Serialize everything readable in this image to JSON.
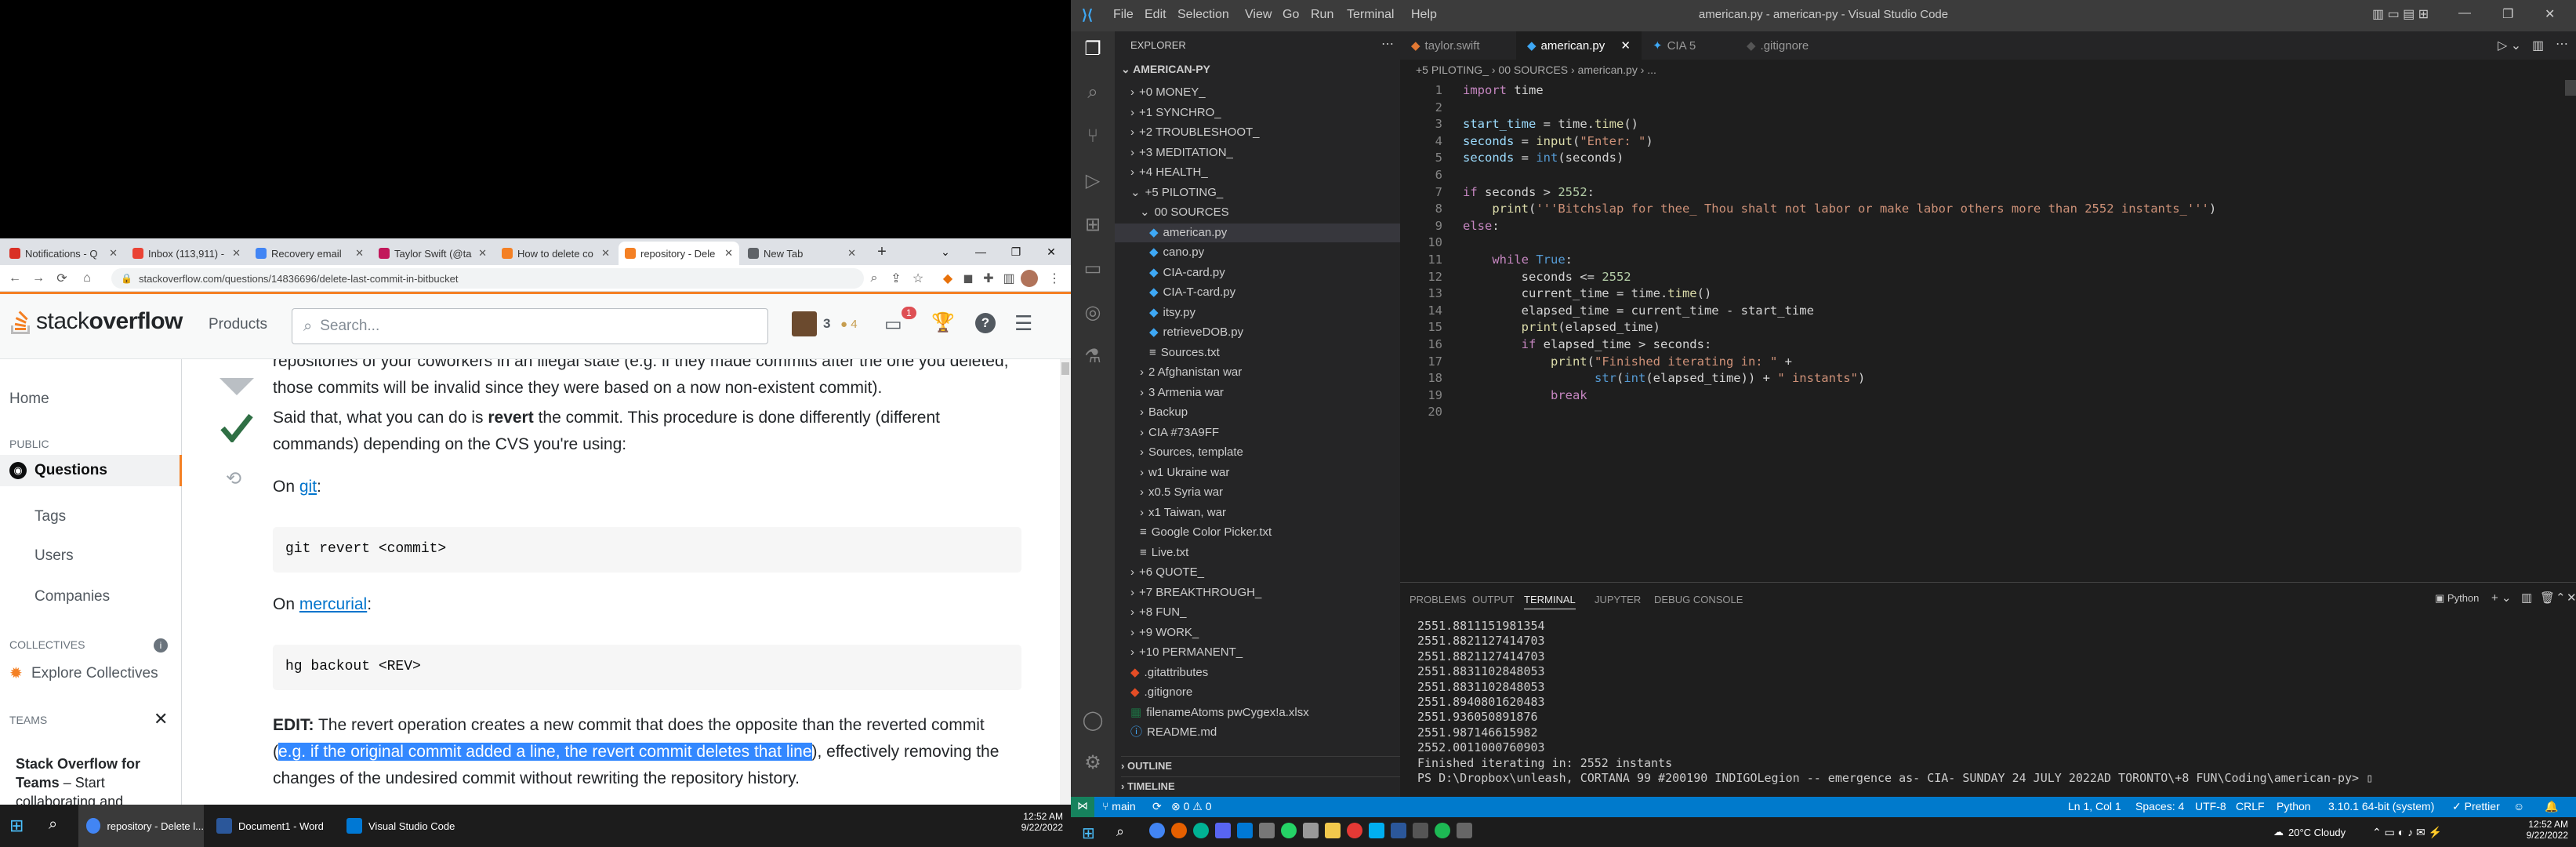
{
  "browser": {
    "tabs": [
      {
        "label": "Notifications - Q",
        "icon_color": "#d93025"
      },
      {
        "label": "Inbox (113,911) -",
        "icon_color": "#ea4335"
      },
      {
        "label": "Recovery email",
        "icon_color": "#4285f4"
      },
      {
        "label": "Taylor Swift (@ta",
        "icon_color": "#c2185b"
      },
      {
        "label": "How to delete co",
        "icon_color": "#f48024"
      },
      {
        "label": "repository - Dele",
        "icon_color": "#f48024"
      },
      {
        "label": "New Tab",
        "icon_color": "#5f6368"
      }
    ],
    "url": "stackoverflow.com/questions/14836696/delete-last-commit-in-bitbucket",
    "window_buttons": [
      "⌄",
      "—",
      "❐",
      "✕"
    ]
  },
  "so": {
    "logo_text_light": "stack",
    "logo_text_bold": "overflow",
    "products": "Products",
    "search_placeholder": "Search...",
    "rep": "3",
    "badges": "● 4",
    "inbox_count": "1",
    "nav": {
      "home": "Home",
      "public": "PUBLIC",
      "questions": "Questions",
      "tags": "Tags",
      "users": "Users",
      "companies": "Companies",
      "collectives": "COLLECTIVES",
      "explore_collectives": "Explore Collectives",
      "teams": "TEAMS",
      "teams_promo_title": "Stack Overflow for Teams",
      "teams_promo_text": "– Start collaborating and"
    },
    "answer": {
      "para0": "repositories of your coworkers in an illegal state (e.g. if they made commits after the one you deleted, those commits will be invalid since they were based on a now non-existent commit).",
      "para1_a": "Said that, what you can do is ",
      "para1_bold": "revert",
      "para1_b": " the commit. This procedure is done differently (different commands) depending on the CVS you're using:",
      "on_git_a": "On ",
      "on_git_link": "git",
      "on_git_b": ":",
      "code_git": "git revert <commit>",
      "on_hg_a": "On ",
      "on_hg_link": "mercurial",
      "on_hg_b": ":",
      "code_hg": "hg backout <REV>",
      "edit_bold": "EDIT:",
      "edit_a": " The revert operation creates a new commit that does the opposite than the reverted commit (",
      "edit_sel": "e.g. if the original commit added a line, the revert commit deletes that line",
      "edit_b": "), effectively removing the changes of the undesired commit without rewriting the repository history."
    }
  },
  "vscode": {
    "title": "american.py - american-py - Visual Studio Code",
    "menu": [
      "File",
      "Edit",
      "Selection",
      "View",
      "Go",
      "Run",
      "Terminal",
      "Help"
    ],
    "explorer_title": "EXPLORER",
    "root": "AMERICAN-PY",
    "tree": [
      {
        "label": "+0 MONEY_",
        "indent": 1,
        "kind": "folder-closed"
      },
      {
        "label": "+1 SYNCHRO_",
        "indent": 1,
        "kind": "folder-closed"
      },
      {
        "label": "+2 TROUBLESHOOT_",
        "indent": 1,
        "kind": "folder-closed"
      },
      {
        "label": "+3 MEDITATION_",
        "indent": 1,
        "kind": "folder-closed"
      },
      {
        "label": "+4 HEALTH_",
        "indent": 1,
        "kind": "folder-closed"
      },
      {
        "label": "+5 PILOTING_",
        "indent": 1,
        "kind": "folder-open"
      },
      {
        "label": "00 SOURCES",
        "indent": 2,
        "kind": "folder-open"
      },
      {
        "label": "american.py",
        "indent": 3,
        "kind": "py",
        "selected": true
      },
      {
        "label": "cano.py",
        "indent": 3,
        "kind": "py"
      },
      {
        "label": "CIA-card.py",
        "indent": 3,
        "kind": "py"
      },
      {
        "label": "CIA-T-card.py",
        "indent": 3,
        "kind": "py"
      },
      {
        "label": "itsy.py",
        "indent": 3,
        "kind": "py"
      },
      {
        "label": "retrieveDOB.py",
        "indent": 3,
        "kind": "py"
      },
      {
        "label": "Sources.txt",
        "indent": 3,
        "kind": "txt"
      },
      {
        "label": "2 Afghanistan war",
        "indent": 2,
        "kind": "folder-closed"
      },
      {
        "label": "3 Armenia war",
        "indent": 2,
        "kind": "folder-closed"
      },
      {
        "label": "Backup",
        "indent": 2,
        "kind": "folder-closed"
      },
      {
        "label": "CIA  #73A9FF",
        "indent": 2,
        "kind": "folder-closed"
      },
      {
        "label": "Sources, template",
        "indent": 2,
        "kind": "folder-closed"
      },
      {
        "label": "w1 Ukraine war",
        "indent": 2,
        "kind": "folder-closed"
      },
      {
        "label": "x0.5 Syria war",
        "indent": 2,
        "kind": "folder-closed"
      },
      {
        "label": "x1 Taiwan, war",
        "indent": 2,
        "kind": "folder-closed"
      },
      {
        "label": "Google Color Picker.txt",
        "indent": 2,
        "kind": "txt"
      },
      {
        "label": "Live.txt",
        "indent": 2,
        "kind": "txt"
      },
      {
        "label": "+6 QUOTE_",
        "indent": 1,
        "kind": "folder-closed"
      },
      {
        "label": "+7 BREAKTHROUGH_",
        "indent": 1,
        "kind": "folder-closed"
      },
      {
        "label": "+8 FUN_",
        "indent": 1,
        "kind": "folder-closed"
      },
      {
        "label": "+9 WORK_",
        "indent": 1,
        "kind": "folder-closed"
      },
      {
        "label": "+10 PERMANENT_",
        "indent": 1,
        "kind": "folder-closed"
      },
      {
        "label": ".gitattributes",
        "indent": 1,
        "kind": "git"
      },
      {
        "label": ".gitignore",
        "indent": 1,
        "kind": "git"
      },
      {
        "label": "filenameAtoms pwCygex!a.xlsx",
        "indent": 1,
        "kind": "xlsx"
      },
      {
        "label": "README.md",
        "indent": 1,
        "kind": "md"
      }
    ],
    "outline": "OUTLINE",
    "timeline": "TIMELINE",
    "editor_tabs": [
      {
        "label": "taylor.swift",
        "active": false
      },
      {
        "label": "american.py",
        "active": true
      },
      {
        "label": "CIA 5",
        "active": false
      },
      {
        "label": ".gitignore",
        "active": false
      }
    ],
    "breadcrumbs": "+5 PILOTING_ › 00 SOURCES › american.py › ...",
    "code_lines": [
      [
        [
          "kw",
          "import"
        ],
        [
          "cm",
          " time"
        ]
      ],
      [],
      [
        [
          "vr",
          "start_time"
        ],
        [
          "cm",
          " = time."
        ],
        [
          "fn",
          "time"
        ],
        [
          "cm",
          "()"
        ]
      ],
      [
        [
          "vr",
          "seconds"
        ],
        [
          "cm",
          " = "
        ],
        [
          "fn",
          "input"
        ],
        [
          "cm",
          "("
        ],
        [
          "st",
          "\"Enter: \""
        ],
        [
          "cm",
          ")"
        ]
      ],
      [
        [
          "vr",
          "seconds"
        ],
        [
          "cm",
          " = "
        ],
        [
          "kb",
          "int"
        ],
        [
          "cm",
          "(seconds)"
        ]
      ],
      [],
      [
        [
          "kw",
          "if"
        ],
        [
          "cm",
          " seconds > "
        ],
        [
          "nm",
          "2552"
        ],
        [
          "cm",
          ":"
        ]
      ],
      [
        [
          "cm",
          "    "
        ],
        [
          "fn",
          "print"
        ],
        [
          "cm",
          "("
        ],
        [
          "st",
          "'''Bitchslap for thee_ Thou shalt not labor or make labor others more than 2552 instants_'''"
        ],
        [
          "cm",
          ")"
        ]
      ],
      [
        [
          "kw",
          "else"
        ],
        [
          "cm",
          ":"
        ]
      ],
      [],
      [
        [
          "cm",
          "    "
        ],
        [
          "kw",
          "while"
        ],
        [
          "cm",
          " "
        ],
        [
          "kb",
          "True"
        ],
        [
          "cm",
          ":"
        ]
      ],
      [
        [
          "cm",
          "        seconds <= "
        ],
        [
          "nm",
          "2552"
        ]
      ],
      [
        [
          "cm",
          "        current_time = time."
        ],
        [
          "fn",
          "time"
        ],
        [
          "cm",
          "()"
        ]
      ],
      [
        [
          "cm",
          "        elapsed_time = current_time - start_time"
        ]
      ],
      [
        [
          "cm",
          "        "
        ],
        [
          "fn",
          "print"
        ],
        [
          "cm",
          "(elapsed_time)"
        ]
      ],
      [
        [
          "cm",
          "        "
        ],
        [
          "kw",
          "if"
        ],
        [
          "cm",
          " elapsed_time > seconds:"
        ]
      ],
      [
        [
          "cm",
          "            "
        ],
        [
          "fn",
          "print"
        ],
        [
          "cm",
          "("
        ],
        [
          "st",
          "\"Finished iterating in: \""
        ],
        [
          "cm",
          " +"
        ]
      ],
      [
        [
          "cm",
          "                  "
        ],
        [
          "kb",
          "str"
        ],
        [
          "cm",
          "("
        ],
        [
          "kb",
          "int"
        ],
        [
          "cm",
          "(elapsed_time)) + "
        ],
        [
          "st",
          "\" instants\""
        ],
        [
          "cm",
          ")"
        ]
      ],
      [
        [
          "cm",
          "            "
        ],
        [
          "kw",
          "break"
        ]
      ],
      []
    ],
    "panel_tabs": [
      "PROBLEMS",
      "OUTPUT",
      "TERMINAL",
      "JUPYTER",
      "DEBUG CONSOLE"
    ],
    "panel_active": "TERMINAL",
    "terminal_shell": "Python",
    "terminal_lines": [
      "2551.8811151981354",
      "2551.8821127414703",
      "2551.8821127414703",
      "2551.8831102848053",
      "2551.8831102848053",
      "2551.8940801620483",
      "2551.936050891876",
      "2551.987146615982",
      "2552.0011000760903",
      "Finished iterating in: 2552 instants",
      "PS D:\\Dropbox\\unleash, CORTANA 99 #200190 INDIGOLegion -- emergence as- CIA- SUNDAY 24 JULY 2022AD TORONTO\\+8 FUN\\Coding\\american-py> ▯"
    ],
    "status": {
      "branch": "main",
      "errors": "⊗ 0 ⚠ 0",
      "position": "Ln 1, Col 1",
      "spaces": "Spaces: 4",
      "encoding": "UTF-8",
      "eol": "CRLF",
      "language": "Python",
      "interpreter": "3.10.1 64-bit (system)",
      "prettier": "✓ Prettier"
    }
  },
  "taskbar_left": {
    "apps": [
      {
        "label": "repository - Delete l...",
        "color": "#4285f4"
      },
      {
        "label": "Document1 - Word",
        "color": "#2b579a"
      },
      {
        "label": "Visual Studio Code",
        "color": "#0078d4"
      }
    ],
    "time": "12:52 AM",
    "date": "9/22/2022"
  },
  "taskbar_right": {
    "weather": "20°C  Cloudy",
    "time": "12:52 AM",
    "date": "9/22/2022"
  }
}
